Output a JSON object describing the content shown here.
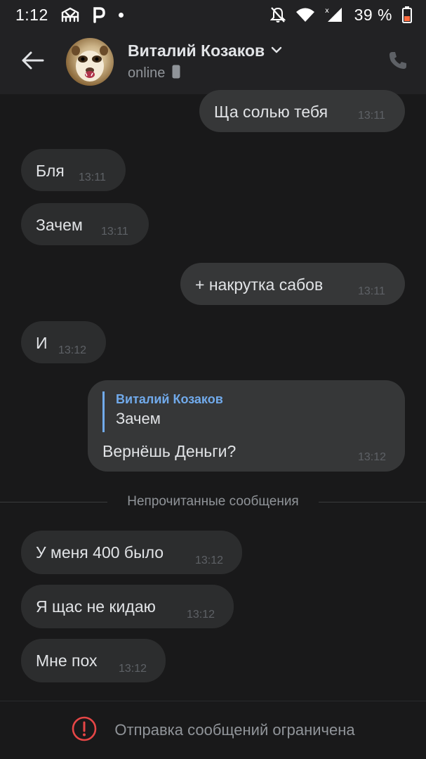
{
  "status_bar": {
    "time": "1:12",
    "battery": "39 %",
    "icons": [
      "bridge-icon",
      "parking-icon",
      "notification-dot-icon",
      "muted-bell-icon",
      "wifi-icon",
      "signal-icon",
      "battery-icon"
    ]
  },
  "header": {
    "name": "Виталий Козаков",
    "status": "online",
    "icons": [
      "back-arrow-icon",
      "chevron-down-icon",
      "mobile-device-icon",
      "phone-icon"
    ]
  },
  "messages": [
    {
      "direction": "out",
      "text": "Ща солью тебя",
      "time": "13:11"
    },
    {
      "direction": "in",
      "text": "Бля",
      "time": "13:11"
    },
    {
      "direction": "in",
      "text": "Зачем",
      "time": "13:11"
    },
    {
      "direction": "out",
      "text": "+ накрутка сабов",
      "time": "13:11"
    },
    {
      "direction": "in",
      "text": "И",
      "time": "13:12"
    },
    {
      "direction": "out",
      "reply": {
        "author": "Виталий Козаков",
        "text": "Зачем"
      },
      "text": "Вернёшь Деньги?",
      "time": "13:12"
    },
    {
      "direction": "in",
      "text": "У меня 400 было",
      "time": "13:12"
    },
    {
      "direction": "in",
      "text": "Я щас не кидаю",
      "time": "13:12"
    },
    {
      "direction": "in",
      "text": "Мне пох",
      "time": "13:12"
    }
  ],
  "unread_divider": "Непрочитанные сообщения",
  "footer": {
    "text": "Отправка сообщений ограничена",
    "icon": "alert-circle-icon"
  },
  "colors": {
    "background": "#19191a",
    "header": "#222224",
    "bubble_in": "#2c2d2e",
    "bubble_out": "#363738",
    "accent": "#71aaeb",
    "alert": "#e64646"
  }
}
